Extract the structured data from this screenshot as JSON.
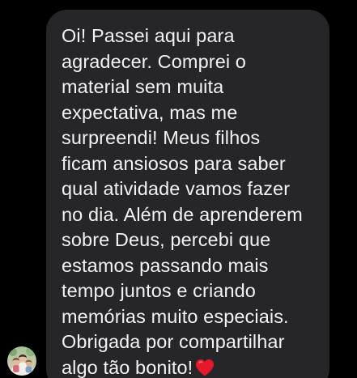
{
  "conversation": {
    "message": {
      "lines": [
        "Oi! Passei aqui para",
        "agradecer. Comprei o",
        "material sem muita",
        "expectativa, mas me",
        "surpreendi! Meus filhos",
        "ficam ansiosos para saber",
        "qual atividade vamos fazer",
        "no dia. Além de aprenderem",
        "sobre Deus, percebi que",
        "estamos passando mais",
        "tempo juntos e criando",
        "memórias muito especiais.",
        "Obrigada por compartilhar",
        "algo tão bonito!"
      ],
      "emoji": "red-heart",
      "bubble_color": "#262629",
      "text_color": "#f2f2f2"
    },
    "sender_avatar": "avatar-photo"
  },
  "theme": {
    "background": "#000000",
    "heart_color": "#e8182c"
  }
}
